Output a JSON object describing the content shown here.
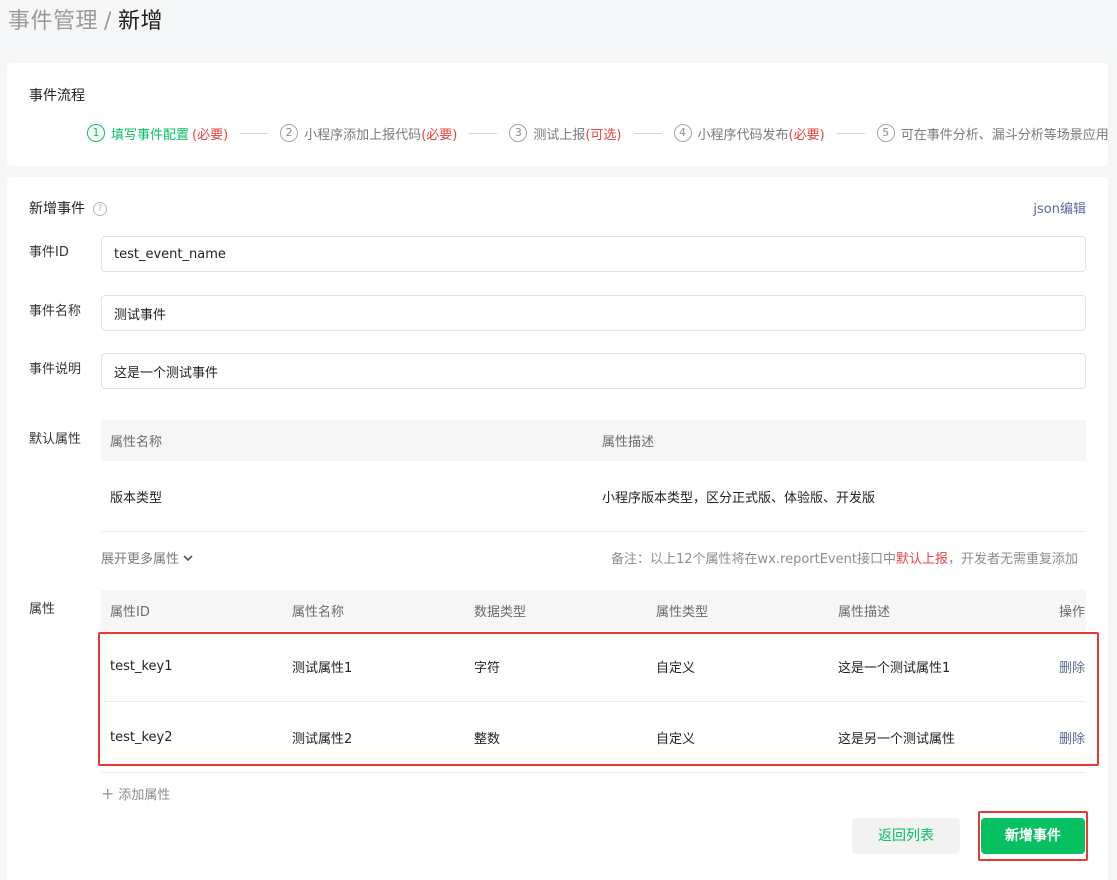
{
  "breadcrumb": {
    "parent": "事件管理",
    "separator": "/",
    "current": "新增"
  },
  "flow": {
    "title": "事件流程",
    "steps": [
      {
        "num": "1",
        "text": "填写事件配置",
        "tag": "(必要)"
      },
      {
        "num": "2",
        "text": "小程序添加上报代码",
        "tag": "(必要)"
      },
      {
        "num": "3",
        "text": "测试上报",
        "tag": "(可选)"
      },
      {
        "num": "4",
        "text": "小程序代码发布",
        "tag": "(必要)"
      },
      {
        "num": "5",
        "text": "可在事件分析、漏斗分析等场景应用",
        "tag": ""
      }
    ]
  },
  "form": {
    "title": "新增事件",
    "help_icon": "?",
    "json_link": "json编辑",
    "event_id": {
      "label": "事件ID",
      "value": "test_event_name"
    },
    "event_name": {
      "label": "事件名称",
      "value": "测试事件"
    },
    "event_desc": {
      "label": "事件说明",
      "value": "这是一个测试事件"
    },
    "default_attrs": {
      "label": "默认属性",
      "headers": [
        "属性名称",
        "属性描述"
      ],
      "rows": [
        {
          "name": "版本类型",
          "desc": "小程序版本类型，区分正式版、体验版、开发版"
        }
      ],
      "expand": "展开更多属性",
      "note_prefix": "备注：以上12个属性将在wx.reportEvent接口中",
      "note_highlight": "默认上报",
      "note_suffix": "，开发者无需重复添加"
    },
    "attrs": {
      "label": "属性",
      "headers": [
        "属性ID",
        "属性名称",
        "数据类型",
        "属性类型",
        "属性描述",
        "操作"
      ],
      "rows": [
        {
          "id": "test_key1",
          "name": "测试属性1",
          "type": "字符",
          "kind": "自定义",
          "desc": "这是一个测试属性1",
          "action": "删除"
        },
        {
          "id": "test_key2",
          "name": "测试属性2",
          "type": "整数",
          "kind": "自定义",
          "desc": "这是另一个测试属性",
          "action": "删除"
        }
      ],
      "add": "添加属性"
    },
    "buttons": {
      "back": "返回列表",
      "submit": "新增事件"
    }
  },
  "colors": {
    "accent": "#07c160",
    "required": "#e64340",
    "link": "#576b95",
    "highlight_box": "#e33b2e"
  }
}
